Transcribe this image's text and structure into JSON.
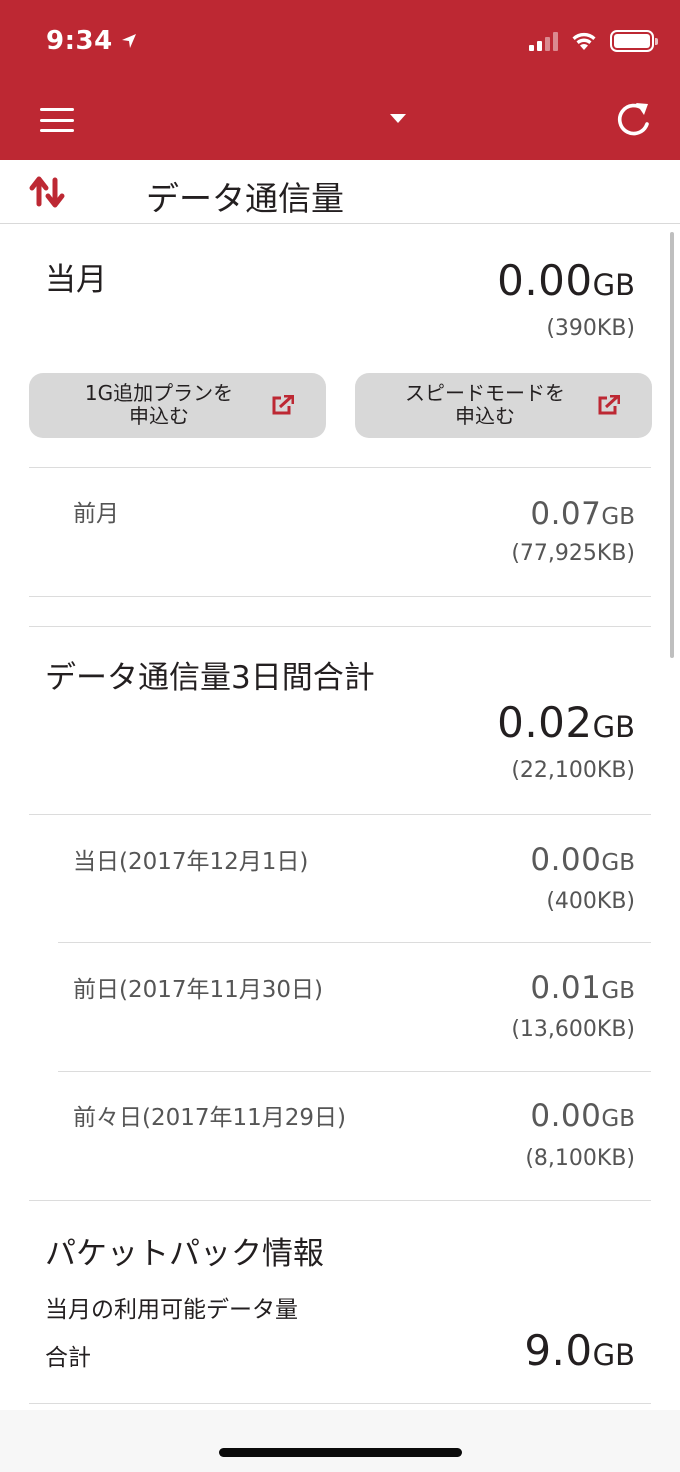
{
  "status_bar": {
    "time": "9:34"
  },
  "colors": {
    "brand": "#bd2833",
    "accent": "#bd2833"
  },
  "header": {
    "menu_icon": "hamburger-icon",
    "dropdown_icon": "caret-down-icon",
    "refresh_icon": "refresh-icon"
  },
  "titlebar": {
    "icon": "data-transfer-icon",
    "title": "データ通信量"
  },
  "current_month": {
    "label": "当月",
    "value": "0.00",
    "unit": "GB",
    "kb": "(390KB)",
    "buttons": [
      {
        "line1": "1G追加プランを",
        "line2": "申込む",
        "icon": "external-link-icon"
      },
      {
        "line1": "スピードモードを",
        "line2": "申込む",
        "icon": "external-link-icon"
      }
    ]
  },
  "previous_month": {
    "label": "前月",
    "value": "0.07",
    "unit": "GB",
    "kb": "(77,925KB)"
  },
  "three_day": {
    "label": "データ通信量3日間合計",
    "value": "0.02",
    "unit": "GB",
    "kb": "(22,100KB)",
    "days": [
      {
        "label": "当日(2017年12月1日)",
        "value": "0.00",
        "unit": "GB",
        "kb": "(400KB)"
      },
      {
        "label": "前日(2017年11月30日)",
        "value": "0.01",
        "unit": "GB",
        "kb": "(13,600KB)"
      },
      {
        "label": "前々日(2017年11月29日)",
        "value": "0.00",
        "unit": "GB",
        "kb": "(8,100KB)"
      }
    ]
  },
  "packet_pack": {
    "title": "パケットパック情報",
    "subtitle": "当月の利用可能データ量",
    "total_label": "合計",
    "value": "9.0",
    "unit": "GB"
  }
}
